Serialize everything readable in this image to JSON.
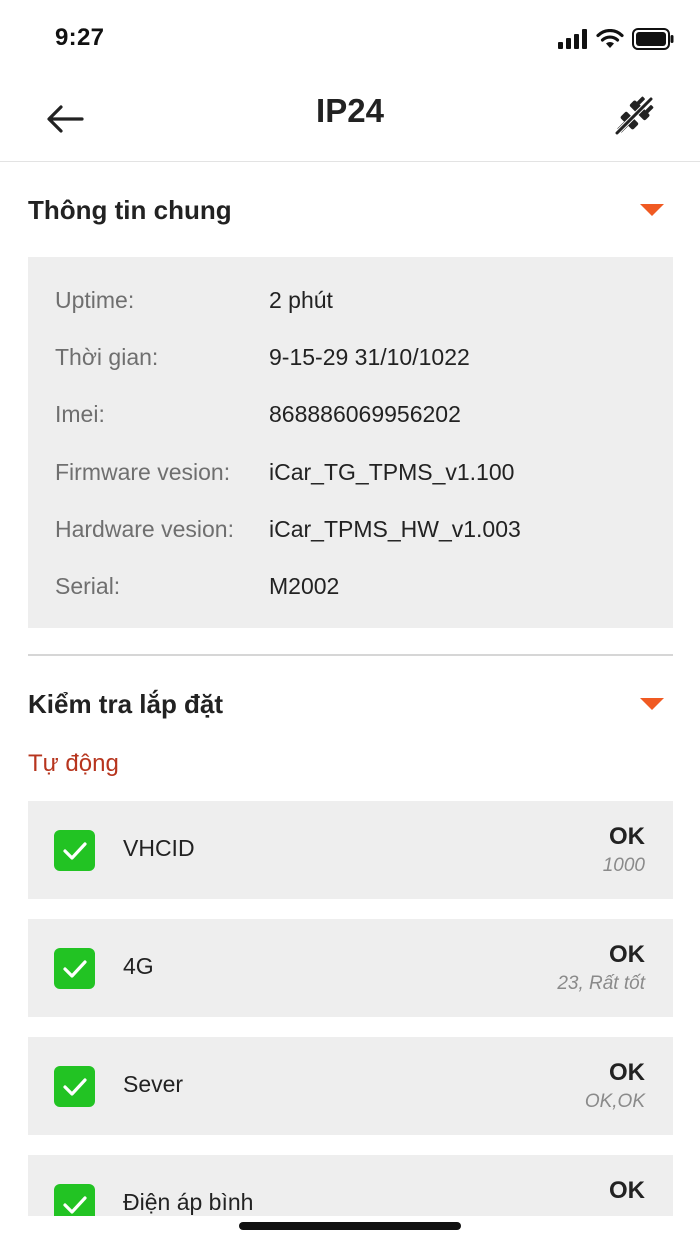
{
  "status_bar": {
    "time": "9:27",
    "icons": [
      "cellular-signal-icon",
      "wifi-icon",
      "battery-icon"
    ]
  },
  "app_bar": {
    "title": "IP24",
    "back_icon": "arrow-left-icon",
    "action_icon": "plug-disconnect-icon"
  },
  "general_info": {
    "title": "Thông tin chung",
    "rows": [
      {
        "label": "Uptime:",
        "value": "2 phút"
      },
      {
        "label": "Thời gian:",
        "value": "9-15-29 31/10/1022"
      },
      {
        "label": "Imei:",
        "value": "868886069956202"
      },
      {
        "label": "Firmware vesion:",
        "value": "iCar_TG_TPMS_v1.100"
      },
      {
        "label": "Hardware vesion:",
        "value": "iCar_TPMS_HW_v1.003"
      },
      {
        "label": "Serial:",
        "value": "M2002"
      }
    ]
  },
  "install_check": {
    "title": "Kiểm tra lắp đặt",
    "subtitle": "Tự động",
    "items": [
      {
        "name": "VHCID",
        "status": "OK",
        "detail": "1000",
        "checked": true
      },
      {
        "name": "4G",
        "status": "OK",
        "detail": "23, Rất tốt",
        "checked": true
      },
      {
        "name": "Sever",
        "status": "OK",
        "detail": "OK,OK",
        "checked": true
      },
      {
        "name": "Điện áp bình",
        "status": "OK",
        "detail": "",
        "checked": true
      }
    ]
  },
  "colors": {
    "accent": "#f05a22",
    "check_green": "#22c323",
    "subtitle_red": "#b7351e",
    "card_bg": "#eeeeee"
  }
}
